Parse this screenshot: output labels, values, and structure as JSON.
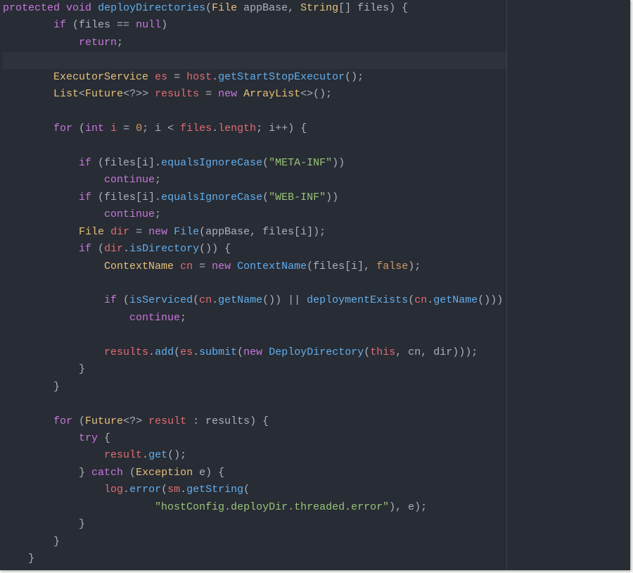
{
  "editor": {
    "theme_colors": {
      "background": "#282c34",
      "keyword": "#c678dd",
      "type": "#e5c07b",
      "function": "#61afef",
      "variable": "#e06c75",
      "string": "#98c379",
      "number": "#d19a66",
      "plain": "#abb2bf"
    },
    "highlighted_line": 4,
    "lines": [
      [
        [
          "kw",
          "protected"
        ],
        [
          "pl",
          " "
        ],
        [
          "kw",
          "void"
        ],
        [
          "pl",
          " "
        ],
        [
          "fn",
          "deployDirectories"
        ],
        [
          "pl",
          "("
        ],
        [
          "ty",
          "File"
        ],
        [
          "pl",
          " appBase, "
        ],
        [
          "ty",
          "String"
        ],
        [
          "pl",
          "[] files) {"
        ]
      ],
      [
        [
          "pl",
          "        "
        ],
        [
          "kw",
          "if"
        ],
        [
          "pl",
          " (files == "
        ],
        [
          "kw",
          "null"
        ],
        [
          "pl",
          ")"
        ]
      ],
      [
        [
          "pl",
          "            "
        ],
        [
          "kw",
          "return"
        ],
        [
          "pl",
          ";"
        ]
      ],
      [],
      [
        [
          "pl",
          "        "
        ],
        [
          "ty",
          "ExecutorService"
        ],
        [
          "pl",
          " "
        ],
        [
          "var",
          "es"
        ],
        [
          "pl",
          " = "
        ],
        [
          "var",
          "host"
        ],
        [
          "pl",
          "."
        ],
        [
          "fn",
          "getStartStopExecutor"
        ],
        [
          "pl",
          "();"
        ]
      ],
      [
        [
          "pl",
          "        "
        ],
        [
          "ty",
          "List"
        ],
        [
          "pl",
          "<"
        ],
        [
          "ty",
          "Future"
        ],
        [
          "pl",
          "<?>> "
        ],
        [
          "var",
          "results"
        ],
        [
          "pl",
          " = "
        ],
        [
          "kw",
          "new"
        ],
        [
          "pl",
          " "
        ],
        [
          "ty",
          "ArrayList"
        ],
        [
          "pl",
          "<>();"
        ]
      ],
      [],
      [
        [
          "pl",
          "        "
        ],
        [
          "kw",
          "for"
        ],
        [
          "pl",
          " ("
        ],
        [
          "kw",
          "int"
        ],
        [
          "pl",
          " "
        ],
        [
          "var",
          "i"
        ],
        [
          "pl",
          " = "
        ],
        [
          "nm",
          "0"
        ],
        [
          "pl",
          "; i < "
        ],
        [
          "var",
          "files"
        ],
        [
          "pl",
          "."
        ],
        [
          "var",
          "length"
        ],
        [
          "pl",
          "; i++) {"
        ]
      ],
      [],
      [
        [
          "pl",
          "            "
        ],
        [
          "kw",
          "if"
        ],
        [
          "pl",
          " (files[i]."
        ],
        [
          "fn",
          "equalsIgnoreCase"
        ],
        [
          "pl",
          "("
        ],
        [
          "st",
          "\"META-INF\""
        ],
        [
          "pl",
          "))"
        ]
      ],
      [
        [
          "pl",
          "                "
        ],
        [
          "kw",
          "continue"
        ],
        [
          "pl",
          ";"
        ]
      ],
      [
        [
          "pl",
          "            "
        ],
        [
          "kw",
          "if"
        ],
        [
          "pl",
          " (files[i]."
        ],
        [
          "fn",
          "equalsIgnoreCase"
        ],
        [
          "pl",
          "("
        ],
        [
          "st",
          "\"WEB-INF\""
        ],
        [
          "pl",
          "))"
        ]
      ],
      [
        [
          "pl",
          "                "
        ],
        [
          "kw",
          "continue"
        ],
        [
          "pl",
          ";"
        ]
      ],
      [
        [
          "pl",
          "            "
        ],
        [
          "ty",
          "File"
        ],
        [
          "pl",
          " "
        ],
        [
          "var",
          "dir"
        ],
        [
          "pl",
          " = "
        ],
        [
          "kw",
          "new"
        ],
        [
          "pl",
          " "
        ],
        [
          "fn",
          "File"
        ],
        [
          "pl",
          "(appBase, files[i]);"
        ]
      ],
      [
        [
          "pl",
          "            "
        ],
        [
          "kw",
          "if"
        ],
        [
          "pl",
          " ("
        ],
        [
          "var",
          "dir"
        ],
        [
          "pl",
          "."
        ],
        [
          "fn",
          "isDirectory"
        ],
        [
          "pl",
          "()) {"
        ]
      ],
      [
        [
          "pl",
          "                "
        ],
        [
          "ty",
          "ContextName"
        ],
        [
          "pl",
          " "
        ],
        [
          "var",
          "cn"
        ],
        [
          "pl",
          " = "
        ],
        [
          "kw",
          "new"
        ],
        [
          "pl",
          " "
        ],
        [
          "fn",
          "ContextName"
        ],
        [
          "pl",
          "(files[i], "
        ],
        [
          "nm",
          "false"
        ],
        [
          "pl",
          ");"
        ]
      ],
      [],
      [
        [
          "pl",
          "                "
        ],
        [
          "kw",
          "if"
        ],
        [
          "pl",
          " ("
        ],
        [
          "fn",
          "isServiced"
        ],
        [
          "pl",
          "("
        ],
        [
          "var",
          "cn"
        ],
        [
          "pl",
          "."
        ],
        [
          "fn",
          "getName"
        ],
        [
          "pl",
          "()) || "
        ],
        [
          "fn",
          "deploymentExists"
        ],
        [
          "pl",
          "("
        ],
        [
          "var",
          "cn"
        ],
        [
          "pl",
          "."
        ],
        [
          "fn",
          "getName"
        ],
        [
          "pl",
          "()))"
        ]
      ],
      [
        [
          "pl",
          "                    "
        ],
        [
          "kw",
          "continue"
        ],
        [
          "pl",
          ";"
        ]
      ],
      [],
      [
        [
          "pl",
          "                "
        ],
        [
          "var",
          "results"
        ],
        [
          "pl",
          "."
        ],
        [
          "fn",
          "add"
        ],
        [
          "pl",
          "("
        ],
        [
          "var",
          "es"
        ],
        [
          "pl",
          "."
        ],
        [
          "fn",
          "submit"
        ],
        [
          "pl",
          "("
        ],
        [
          "kw",
          "new"
        ],
        [
          "pl",
          " "
        ],
        [
          "fn",
          "DeployDirectory"
        ],
        [
          "pl",
          "("
        ],
        [
          "var",
          "this"
        ],
        [
          "pl",
          ", cn, dir)));"
        ]
      ],
      [
        [
          "pl",
          "            }"
        ]
      ],
      [
        [
          "pl",
          "        }"
        ]
      ],
      [],
      [
        [
          "pl",
          "        "
        ],
        [
          "kw",
          "for"
        ],
        [
          "pl",
          " ("
        ],
        [
          "ty",
          "Future"
        ],
        [
          "pl",
          "<?> "
        ],
        [
          "var",
          "result"
        ],
        [
          "pl",
          " : results) {"
        ]
      ],
      [
        [
          "pl",
          "            "
        ],
        [
          "kw",
          "try"
        ],
        [
          "pl",
          " {"
        ]
      ],
      [
        [
          "pl",
          "                "
        ],
        [
          "var",
          "result"
        ],
        [
          "pl",
          "."
        ],
        [
          "fn",
          "get"
        ],
        [
          "pl",
          "();"
        ]
      ],
      [
        [
          "pl",
          "            } "
        ],
        [
          "kw",
          "catch"
        ],
        [
          "pl",
          " ("
        ],
        [
          "ty",
          "Exception"
        ],
        [
          "pl",
          " e) {"
        ]
      ],
      [
        [
          "pl",
          "                "
        ],
        [
          "var",
          "log"
        ],
        [
          "pl",
          "."
        ],
        [
          "fn",
          "error"
        ],
        [
          "pl",
          "("
        ],
        [
          "var",
          "sm"
        ],
        [
          "pl",
          "."
        ],
        [
          "fn",
          "getString"
        ],
        [
          "pl",
          "("
        ]
      ],
      [
        [
          "pl",
          "                        "
        ],
        [
          "st",
          "\"hostConfig.deployDir.threaded.error\""
        ],
        [
          "pl",
          "), e);"
        ]
      ],
      [
        [
          "pl",
          "            }"
        ]
      ],
      [
        [
          "pl",
          "        }"
        ]
      ],
      [
        [
          "pl",
          "    }"
        ]
      ]
    ]
  }
}
